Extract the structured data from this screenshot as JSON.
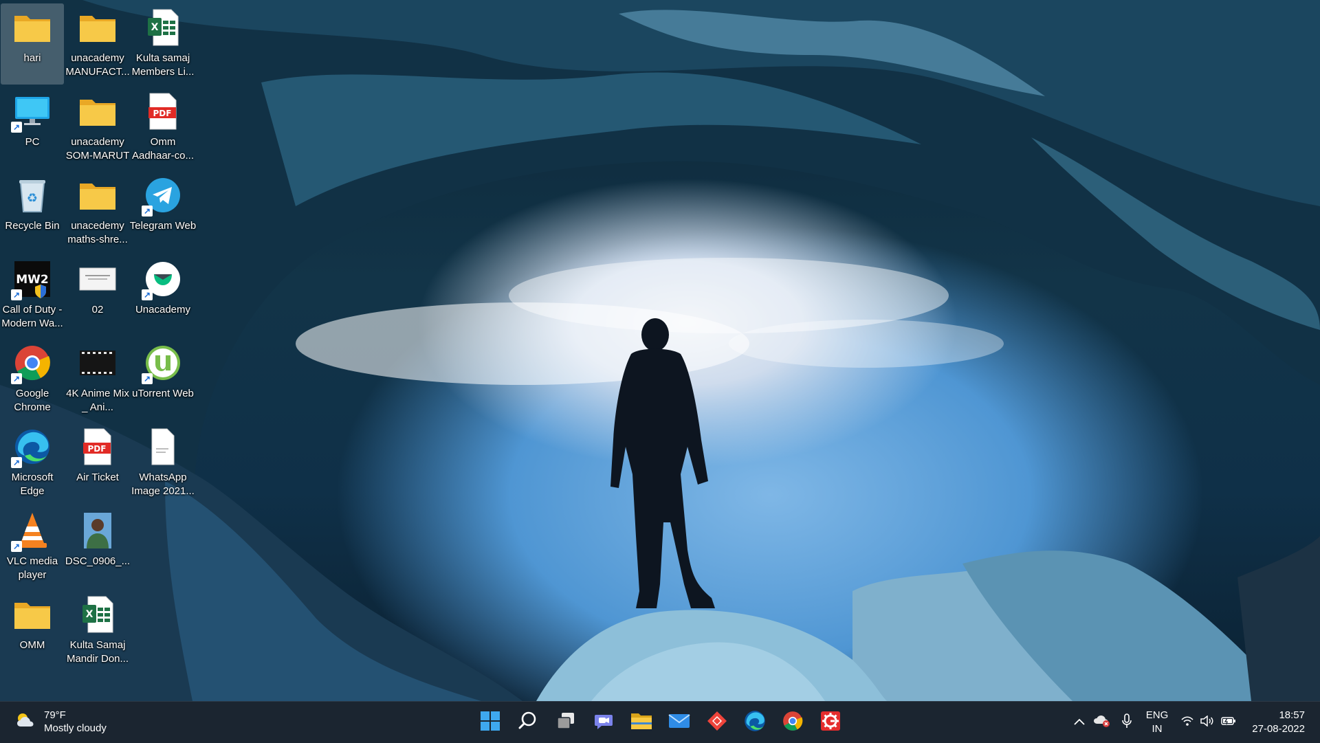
{
  "desktop": {
    "icons": [
      {
        "label": "hari",
        "type": "folder"
      },
      {
        "label": "PC",
        "type": "monitor"
      },
      {
        "label": "Recycle Bin",
        "type": "recycle-bin"
      },
      {
        "label": "Call of Duty - Modern Wa...",
        "type": "game"
      },
      {
        "label": "Google Chrome",
        "type": "chrome"
      },
      {
        "label": "Microsoft Edge",
        "type": "edge"
      },
      {
        "label": "VLC media player",
        "type": "vlc"
      },
      {
        "label": "OMM",
        "type": "folder"
      },
      {
        "label": "unacademy MANUFACT...",
        "type": "folder"
      },
      {
        "label": "unacademy SOM-MARUT",
        "type": "folder"
      },
      {
        "label": "unacedemy maths-shre...",
        "type": "folder"
      },
      {
        "label": "02",
        "type": "document-image"
      },
      {
        "label": "4K Anime Mix _ Ani...",
        "type": "video"
      },
      {
        "label": "Air Ticket",
        "type": "pdf"
      },
      {
        "label": "DSC_0906_...",
        "type": "photo"
      },
      {
        "label": "Kulta Samaj Mandir Don...",
        "type": "excel"
      },
      {
        "label": "Kulta samaj Members Li...",
        "type": "excel"
      },
      {
        "label": "Omm Aadhaar-co...",
        "type": "pdf"
      },
      {
        "label": "Telegram Web",
        "type": "telegram"
      },
      {
        "label": "Unacademy",
        "type": "unacademy"
      },
      {
        "label": "uTorrent Web",
        "type": "utorrent"
      },
      {
        "label": "WhatsApp Image 2021...",
        "type": "image-file"
      }
    ]
  },
  "taskbar": {
    "weather": {
      "temp": "79°F",
      "condition": "Mostly cloudy",
      "icon": "partly-cloudy-icon"
    },
    "apps": [
      {
        "name": "start",
        "icon": "windows-logo-icon"
      },
      {
        "name": "search",
        "icon": "search-icon"
      },
      {
        "name": "task-view",
        "icon": "task-view-icon"
      },
      {
        "name": "chat",
        "icon": "teams-chat-icon"
      },
      {
        "name": "file-explorer",
        "icon": "folder-icon"
      },
      {
        "name": "mail",
        "icon": "mail-icon"
      },
      {
        "name": "anydesk",
        "icon": "anydesk-icon"
      },
      {
        "name": "edge",
        "icon": "edge-icon"
      },
      {
        "name": "chrome",
        "icon": "chrome-icon"
      },
      {
        "name": "red-app",
        "icon": "gear-app-icon"
      }
    ],
    "tray": {
      "lang_line1": "ENG",
      "lang_line2": "IN",
      "time": "18:57",
      "date": "27-08-2022"
    }
  },
  "colors": {
    "taskbar_bg": "#1b2530",
    "folder_yellow": "#f7c948",
    "accent_blue": "#0a84ff"
  }
}
